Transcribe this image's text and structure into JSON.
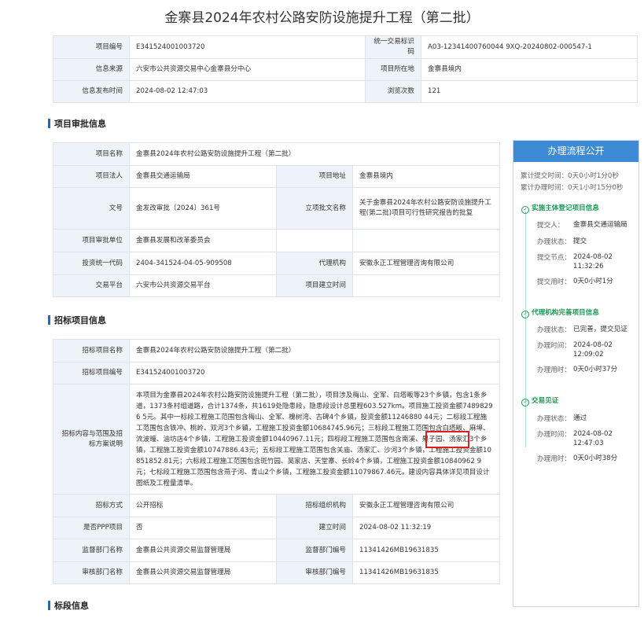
{
  "page_title": "金寨县2024年农村公路安防设施提升工程（第二批）",
  "top_info": {
    "project_no_label": "项目编号",
    "project_no": "E341524001003720",
    "trade_code_label": "统一交易标识码",
    "trade_code": "A03-12341400760044 9XQ-20240802-000547-1",
    "source_label": "信息来源",
    "source": "六安市公共资源交易中心金寨县分中心",
    "location_label": "项目所在地",
    "location": "金寨县境内",
    "publish_time_label": "信息发布时间",
    "publish_time": "2024-08-02 12:47:03",
    "views_label": "浏览次数",
    "views": "121"
  },
  "section_approval": "项目审批信息",
  "approval": {
    "name_label": "项目名称",
    "name": "金寨县2024年农村公路安防设施提升工程（第二批）",
    "legal_label": "项目法人",
    "legal": "金寨县交通运输局",
    "address_label": "项目地址",
    "address": "金寨县境内",
    "doc_label": "文号",
    "doc": "金发改审批〔2024〕361号",
    "approve_doc_label": "立项批文名称",
    "approve_doc": "关于金寨县2024年农村公路安防设施提升工程(第二批)项目可行性研究报告的批复",
    "unit_label": "项目审批单位",
    "unit": "金寨县发展和改革委员会",
    "invest_code_label": "投资统一代码",
    "invest_code": "2404-341524-04-05-909508",
    "agency_label": "代理机构",
    "agency": "安徽永正工程管理咨询有限公司",
    "platform_label": "交易平台",
    "platform": "六安市公共资源交易平台",
    "setup_time_label": "项目建立时间",
    "setup_time": ""
  },
  "section_bidding": "招标项目信息",
  "bidding": {
    "name_label": "招标项目名称",
    "name": "金寨县2024年农村公路安防设施提升工程（第二批）",
    "no_label": "招标项目编号",
    "no": "E341524001003720",
    "content_label": "招标内容与范围及招标方案说明",
    "content": "本项目为金寨县2024年农村公路安防设施提升工程（第二批），项目涉及梅山、全军、白塔畈等23个乡镇，包含1条乡道，1373条村组道路，合计1374条，共1619处隐患段，隐患段设计总里程603.527km。项目施工投资金额74898296 5元。其中一标段工程施工范围包含梅山、全军、槐树湾、古碑4个乡镇，投资金额11246880 44元；二标段工程施工范围包含铁冲、桃岭、双河3个乡镇，工程施工投资金额10684745.96元；三标段工程施工范围包含白塔畈、麻埠、流波疃、油坊店4个乡镇，工程施工投资金额10440967.11元；四标段工程施工范围包含南溪、果子园、汤家汇3个乡镇，工程施工投资金额10747886.43元；五标段工程施工范围包含关庙、汤家汇、沙河3个乡镇，工程施工投资金额10851852.81元；六标段工程施工范围包含斑竹园、吴家店、天堂寨、长岭4个乡镇，工程施工投资金额10840962 9元；七标段工程施工范围包含燕子河、青山2个乡镇，工程施工投资金额11079867.46元。建设内容具体详见项目设计图纸及工程量清单。",
    "method_label": "招标方式",
    "method": "公开招标",
    "org_label": "招标组织机构",
    "org": "安徽永正工程管理咨询有限公司",
    "ppp_label": "是否PPP项目",
    "ppp": "否",
    "created_label": "建立时间",
    "created": "2024-08-02 11:32:19",
    "supervise_label": "监督部门名称",
    "supervise": "金寨县公共资源交易监督管理局",
    "supervise_no_label": "监督部门编号",
    "supervise_no": "11341426MB19631835",
    "audit_label": "审核部门名称",
    "audit": "金寨县公共资源交易监督管理局",
    "audit_no_label": "审核部门编号",
    "audit_no": "11341426MB19631835"
  },
  "section_lots": "标段信息",
  "sidebar": {
    "title": "办理流程公开",
    "total_submit": "累计提交时间：0天0小时1分0秒",
    "total_handle": "累计办理时间：0天1小时15分0秒",
    "steps": [
      {
        "title": "实施主体登记项目信息",
        "rows": [
          {
            "k": "提交人：",
            "v": "金寨县交通运输局"
          },
          {
            "k": "办理状态：",
            "v": "提交"
          },
          {
            "k": "提交节点：",
            "v": "2024-08-02 11:32:26"
          },
          {
            "k": "提交用时：",
            "v": "0天0小时1分"
          }
        ]
      },
      {
        "title": "代理机构完善项目信息",
        "rows": [
          {
            "k": "办理状态：",
            "v": "已完善，提交见证"
          },
          {
            "k": "办理时间：",
            "v": "2024-08-02 12:09:02"
          },
          {
            "k": "办理用时：",
            "v": "0天0小时37分"
          }
        ]
      },
      {
        "title": "交易见证",
        "rows": [
          {
            "k": "办理状态：",
            "v": "通过"
          },
          {
            "k": "办理时间：",
            "v": "2024-08-02 12:47:03"
          },
          {
            "k": "办理用时：",
            "v": "0天0小时38分"
          }
        ]
      }
    ]
  },
  "colors": {
    "accent": "#3d8bd4",
    "label_bg": "#eef3f9",
    "green": "#1a9a57",
    "highlight": "#e02020"
  }
}
